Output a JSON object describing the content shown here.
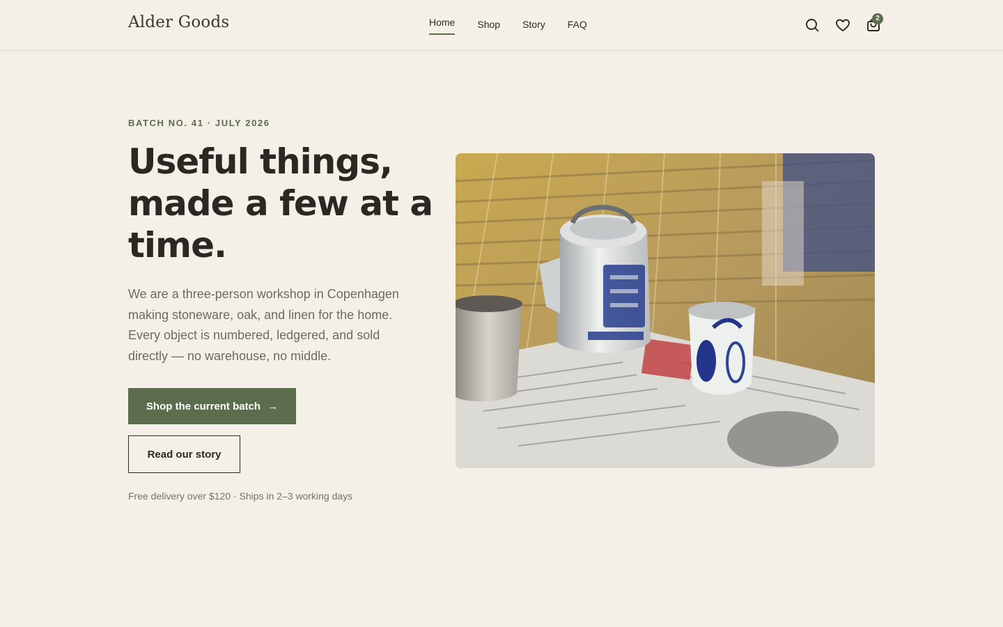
{
  "brand": {
    "name": "Alder Goods"
  },
  "nav": {
    "items": [
      {
        "label": "Home",
        "active": true
      },
      {
        "label": "Shop",
        "active": false
      },
      {
        "label": "Story",
        "active": false
      },
      {
        "label": "FAQ",
        "active": false
      }
    ]
  },
  "header_icons": {
    "search": "search-icon",
    "wishlist": "heart-icon",
    "cart": "shopping-bag-icon",
    "cart_count": "2"
  },
  "hero": {
    "eyebrow": "BATCH NO. 41 · JULY 2026",
    "headline": "Useful things, made a few at a time.",
    "body": "We are a three-person workshop in Copenhagen making stoneware, oak, and linen for the home. Every object is numbered, ledgered, and sold directly — no warehouse, no middle.",
    "primary_cta": "Shop the current batch",
    "primary_cta_icon": "arrow-right-icon",
    "secondary_cta": "Read our story",
    "note": "Free delivery over $120 · Ships in 2–3 working days"
  },
  "colors": {
    "background": "#f4efe7",
    "accent": "#5c6d4d",
    "text": "#2b2823",
    "muted": "#6f6962"
  }
}
